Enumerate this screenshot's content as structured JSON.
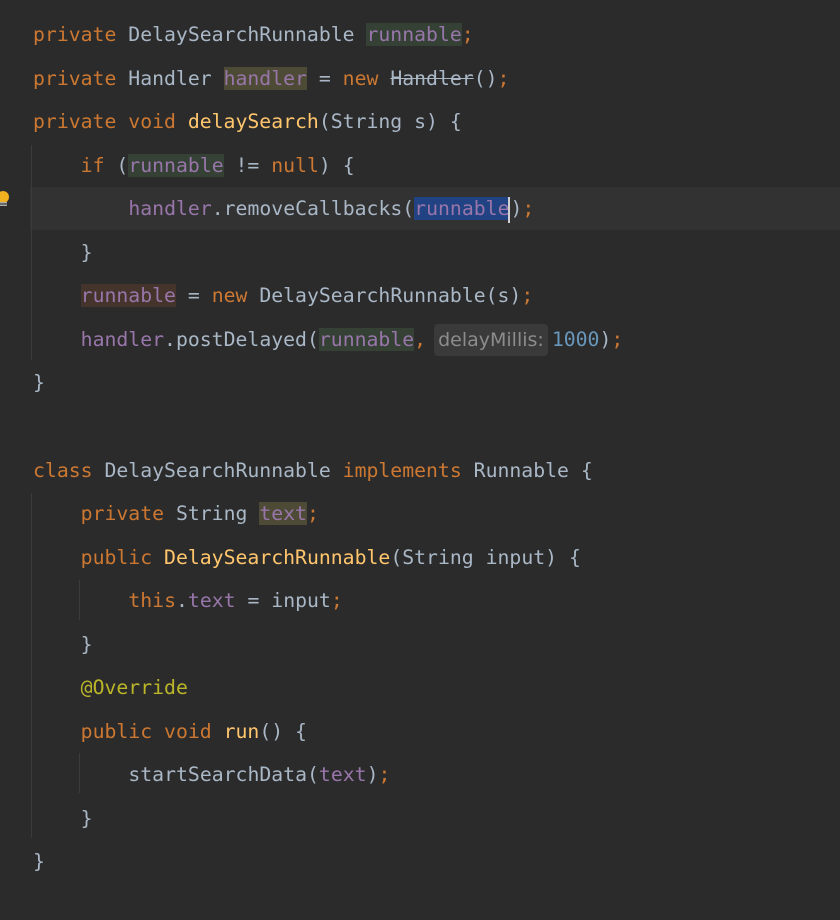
{
  "editor": {
    "lines": [
      {
        "indent": 0,
        "tokens": [
          {
            "t": "private ",
            "c": "kw"
          },
          {
            "t": "DelaySearchRunnable ",
            "c": "pl"
          },
          {
            "t": "runnable",
            "c": "fd hl-read"
          },
          {
            "t": ";",
            "c": "kw"
          }
        ]
      },
      {
        "indent": 0,
        "tokens": [
          {
            "t": "private ",
            "c": "kw"
          },
          {
            "t": "Handler ",
            "c": "pl"
          },
          {
            "t": "handler",
            "c": "fd hl-olive"
          },
          {
            "t": " = ",
            "c": "pl"
          },
          {
            "t": "new ",
            "c": "kw"
          },
          {
            "t": "Handler",
            "c": "pl strike"
          },
          {
            "t": "()",
            "c": "pl"
          },
          {
            "t": ";",
            "c": "kw"
          }
        ]
      },
      {
        "indent": 0,
        "tokens": [
          {
            "t": "private ",
            "c": "kw"
          },
          {
            "t": "void ",
            "c": "kw"
          },
          {
            "t": "delaySearch",
            "c": "fn"
          },
          {
            "t": "(String s) {",
            "c": "pl"
          }
        ]
      },
      {
        "indent": 1,
        "tokens": [
          {
            "t": "if ",
            "c": "kw"
          },
          {
            "t": "(",
            "c": "pl"
          },
          {
            "t": "runnable",
            "c": "fd hl-read"
          },
          {
            "t": " != ",
            "c": "pl"
          },
          {
            "t": "null",
            "c": "kw"
          },
          {
            "t": ") {",
            "c": "pl"
          }
        ]
      },
      {
        "indent": 2,
        "current": true,
        "tokens": [
          {
            "t": "handler",
            "c": "fd"
          },
          {
            "t": ".removeCallbacks(",
            "c": "pl"
          },
          {
            "t": "runnable",
            "c": "fd sel",
            "caret": true
          },
          {
            "t": ")",
            "c": "pl"
          },
          {
            "t": ";",
            "c": "kw"
          }
        ]
      },
      {
        "indent": 1,
        "tokens": [
          {
            "t": "}",
            "c": "pl"
          }
        ]
      },
      {
        "indent": 1,
        "tokens": [
          {
            "t": "runnable",
            "c": "fd hl-write"
          },
          {
            "t": " = ",
            "c": "pl"
          },
          {
            "t": "new ",
            "c": "kw"
          },
          {
            "t": "DelaySearchRunnable(s)",
            "c": "pl"
          },
          {
            "t": ";",
            "c": "kw"
          }
        ]
      },
      {
        "indent": 1,
        "tokens": [
          {
            "t": "handler",
            "c": "fd"
          },
          {
            "t": ".postDelayed(",
            "c": "pl"
          },
          {
            "t": "runnable",
            "c": "fd hl-read"
          },
          {
            "t": ",",
            "c": "kw"
          },
          {
            "t": "delayMillis:",
            "c": "hint"
          },
          {
            "t": "1000",
            "c": "num"
          },
          {
            "t": ")",
            "c": "pl"
          },
          {
            "t": ";",
            "c": "kw"
          }
        ]
      },
      {
        "indent": 0,
        "tokens": [
          {
            "t": "}",
            "c": "pl"
          }
        ]
      },
      {
        "indent": 0,
        "tokens": []
      },
      {
        "indent": 0,
        "tokens": [
          {
            "t": "class ",
            "c": "kw"
          },
          {
            "t": "DelaySearchRunnable ",
            "c": "pl"
          },
          {
            "t": "implements ",
            "c": "kw"
          },
          {
            "t": "Runnable {",
            "c": "pl"
          }
        ]
      },
      {
        "indent": 1,
        "tokens": [
          {
            "t": "private ",
            "c": "kw"
          },
          {
            "t": "String ",
            "c": "pl"
          },
          {
            "t": "text",
            "c": "fd hl-olive"
          },
          {
            "t": ";",
            "c": "kw"
          }
        ]
      },
      {
        "indent": 1,
        "tokens": [
          {
            "t": "public ",
            "c": "kw"
          },
          {
            "t": "DelaySearchRunnable",
            "c": "fn"
          },
          {
            "t": "(String input) {",
            "c": "pl"
          }
        ]
      },
      {
        "indent": 2,
        "tokens": [
          {
            "t": "this",
            "c": "kw"
          },
          {
            "t": ".",
            "c": "pl"
          },
          {
            "t": "text",
            "c": "fd"
          },
          {
            "t": " = input",
            "c": "pl"
          },
          {
            "t": ";",
            "c": "kw"
          }
        ]
      },
      {
        "indent": 1,
        "tokens": [
          {
            "t": "}",
            "c": "pl"
          }
        ]
      },
      {
        "indent": 1,
        "tokens": [
          {
            "t": "@Override",
            "c": "ann"
          }
        ]
      },
      {
        "indent": 1,
        "tokens": [
          {
            "t": "public ",
            "c": "kw"
          },
          {
            "t": "void ",
            "c": "kw"
          },
          {
            "t": "run",
            "c": "fn"
          },
          {
            "t": "() {",
            "c": "pl"
          }
        ]
      },
      {
        "indent": 2,
        "tokens": [
          {
            "t": "startSearchData(",
            "c": "pl"
          },
          {
            "t": "text",
            "c": "fd"
          },
          {
            "t": ")",
            "c": "pl"
          },
          {
            "t": ";",
            "c": "kw"
          }
        ]
      },
      {
        "indent": 1,
        "tokens": [
          {
            "t": "}",
            "c": "pl"
          }
        ]
      },
      {
        "indent": 0,
        "tokens": [
          {
            "t": "}",
            "c": "pl"
          }
        ]
      }
    ]
  }
}
